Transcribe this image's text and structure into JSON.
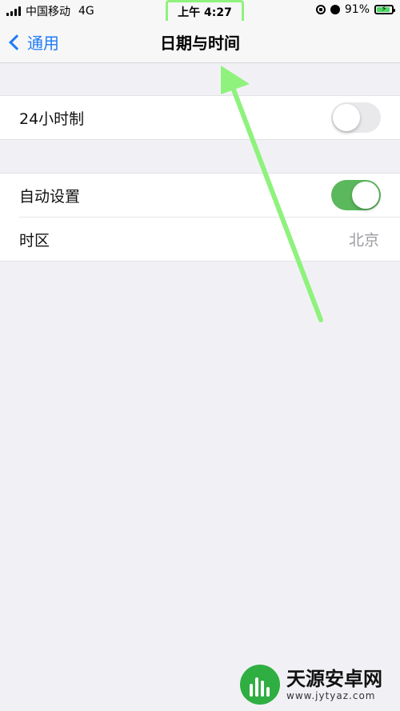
{
  "status_bar": {
    "carrier": "中国移动",
    "network": "4G",
    "time": "上午 4:27",
    "battery": "91%",
    "battery_level": 0.91
  },
  "nav": {
    "back_label": "通用",
    "title": "日期与时间"
  },
  "settings": {
    "hour24": {
      "label": "24小时制",
      "enabled": false
    },
    "auto_set": {
      "label": "自动设置",
      "enabled": true
    },
    "timezone": {
      "label": "时区",
      "value": "北京"
    }
  },
  "colors": {
    "accent": "#1f7bf6",
    "toggle_on": "#5cb85c",
    "annotation": "#8ef27c"
  },
  "watermark": {
    "name": "天源安卓网",
    "url": "www.jytyaz.com"
  }
}
